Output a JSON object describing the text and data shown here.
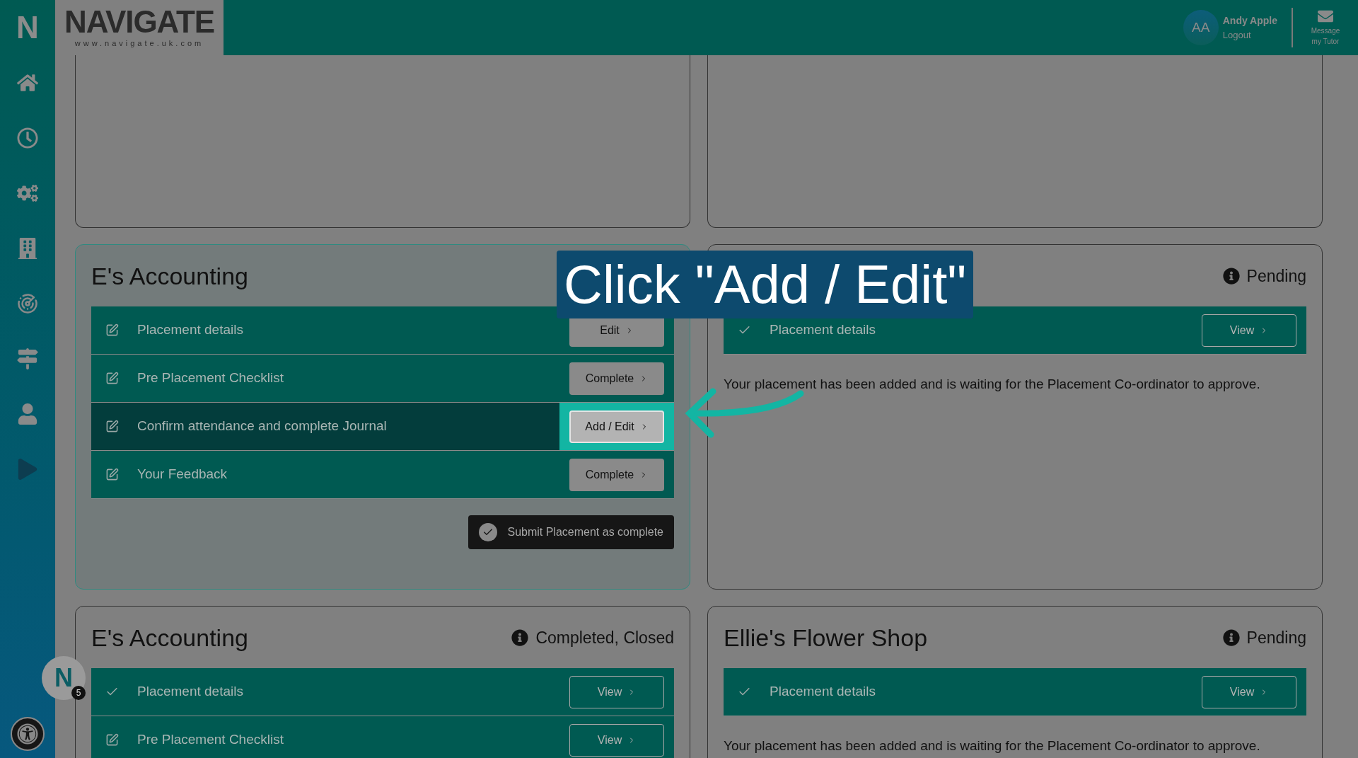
{
  "sidebar": {
    "logo": "N",
    "chat_launcher": {
      "letter": "N",
      "badge": "5"
    }
  },
  "header": {
    "logo": {
      "wordmark": "NAVIGATE",
      "url": "www.navigate.uk.com"
    },
    "user": {
      "initials": "AA",
      "name": "Andy Apple",
      "logout": "Logout"
    },
    "message": {
      "line1": "Message",
      "line2": "my Tutor"
    }
  },
  "callout": "Click \"Add / Edit\"",
  "cards": [
    {
      "kind": "empty"
    },
    {
      "kind": "empty"
    },
    {
      "kind": "full",
      "title": "E's Accounting",
      "rows": [
        {
          "kind": "action",
          "label": "Placement details",
          "button": "Edit",
          "selected": false
        },
        {
          "kind": "action",
          "label": "Pre Placement Checklist",
          "button": "Complete",
          "selected": false
        },
        {
          "kind": "action",
          "label": "Confirm attendance and complete Journal",
          "button": "Add / Edit",
          "selected": true
        },
        {
          "kind": "action",
          "label": "Your Feedback",
          "button": "Complete",
          "selected": false
        }
      ],
      "submit": "Submit Placement as complete"
    },
    {
      "kind": "full",
      "status": "Pending",
      "rows": [
        {
          "kind": "done",
          "label": "Placement details",
          "button": "View",
          "selected": false
        }
      ],
      "message": "Your placement has been added and is waiting for the Placement Co-ordinator to approve."
    },
    {
      "kind": "full",
      "title": "E's Accounting",
      "status": "Completed, Closed",
      "rows": [
        {
          "kind": "done",
          "label": "Placement details",
          "button": "View",
          "selected": false
        },
        {
          "kind": "view",
          "label": "Pre Placement Checklist",
          "button": "View",
          "selected": false
        }
      ]
    },
    {
      "kind": "full",
      "title": "Ellie's Flower Shop",
      "status": "Pending",
      "rows": [
        {
          "kind": "done",
          "label": "Placement details",
          "button": "View",
          "selected": false
        }
      ],
      "message": "Your placement has been added and is waiting for the Placement Co-ordinator to approve."
    }
  ]
}
